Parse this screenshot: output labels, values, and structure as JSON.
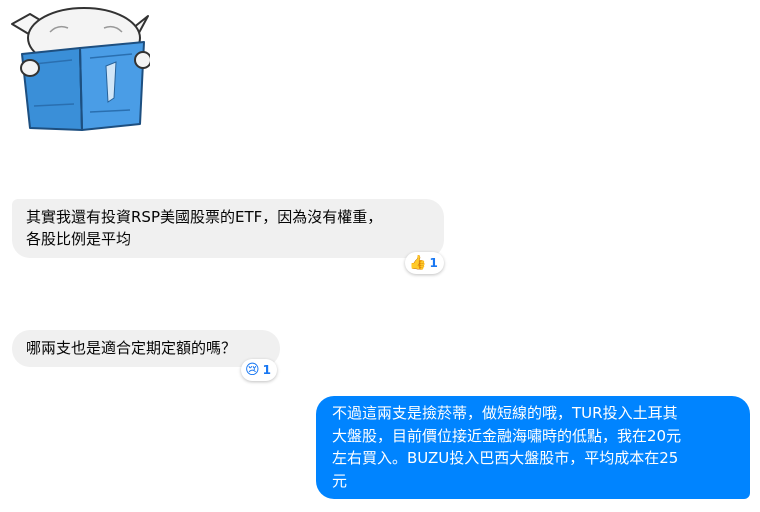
{
  "messages": [
    {
      "text": "其實我還有投資RSP美國股票的ETF，因為沒有權重，\n各股比例是平均",
      "reaction": {
        "icon": "thumbs-up-icon",
        "count": "1"
      }
    },
    {
      "text": "哪兩支也是適合定期定額的嗎？",
      "reaction": {
        "icon": "sad-face-icon",
        "count": "1"
      }
    },
    {
      "text": "不過這兩支是撿菸蒂，做短線的哦，TUR投入土耳其\n大盤股，目前價位接近金融海嘯時的低點，我在20元\n左右買入。BUZU投入巴西大盤股市，平均成本在25\n元"
    }
  ],
  "colors": {
    "outgoing": "#0084ff",
    "incoming": "#f0f0f0",
    "reaction_count": "#1877f2"
  },
  "sticker": {
    "icon": "creature-reading-book-sticker"
  }
}
